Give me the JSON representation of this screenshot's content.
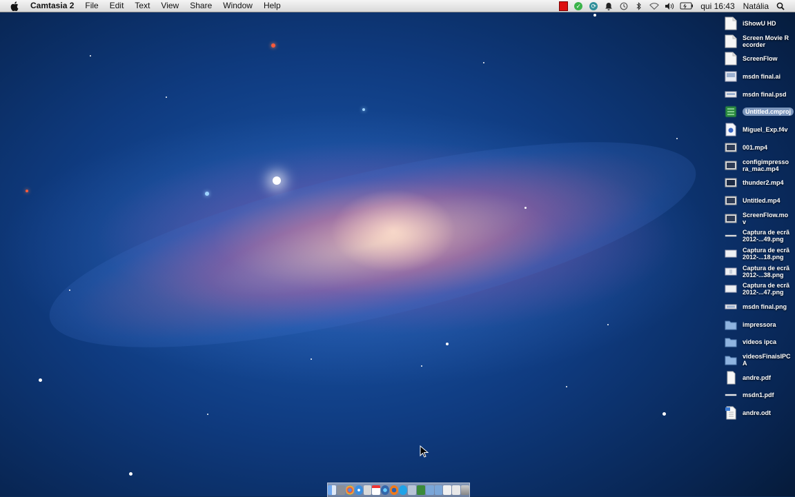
{
  "menubar": {
    "app_name": "Camtasia 2",
    "menus": [
      "File",
      "Edit",
      "Text",
      "View",
      "Share",
      "Window",
      "Help"
    ],
    "clock": "qui 16:43",
    "user": "Natália"
  },
  "desktop_items": [
    {
      "label": "iShowU HD",
      "icon": "document-icon"
    },
    {
      "label": "Screen Movie Recorder",
      "icon": "document-icon"
    },
    {
      "label": "ScreenFlow",
      "icon": "document-icon"
    },
    {
      "label": "msdn final.ai",
      "icon": "image-file-icon"
    },
    {
      "label": "msdn final.psd",
      "icon": "image-file-icon"
    },
    {
      "label": "Untitled.cmproj",
      "icon": "camtasia-project-icon",
      "selected": true
    },
    {
      "label": "Miguel_Exp.f4v",
      "icon": "video-file-icon"
    },
    {
      "label": "001.mp4",
      "icon": "video-file-icon"
    },
    {
      "label": "configimpressora_mac.mp4",
      "icon": "video-file-icon"
    },
    {
      "label": "thunder2.mp4",
      "icon": "video-file-icon"
    },
    {
      "label": "Untitled.mp4",
      "icon": "video-file-icon"
    },
    {
      "label": "ScreenFlow.mov",
      "icon": "video-file-icon"
    },
    {
      "label": "Captura de ecrã 2012-...49.png",
      "icon": "screenshot-file-icon"
    },
    {
      "label": "Captura de ecrã 2012-...18.png",
      "icon": "screenshot-file-icon"
    },
    {
      "label": "Captura de ecrã 2012-...38.png",
      "icon": "screenshot-file-icon"
    },
    {
      "label": "Captura de ecrã 2012-...47.png",
      "icon": "screenshot-file-icon"
    },
    {
      "label": "msdn final.png",
      "icon": "image-file-icon"
    },
    {
      "label": "impressora",
      "icon": "folder-icon"
    },
    {
      "label": "videos ipca",
      "icon": "folder-icon"
    },
    {
      "label": "videosFinaisIPCA",
      "icon": "folder-icon"
    },
    {
      "label": "andre.pdf",
      "icon": "pdf-file-icon"
    },
    {
      "label": "msdn1.pdf",
      "icon": "pdf-file-icon"
    },
    {
      "label": "andre.odt",
      "icon": "text-document-icon"
    }
  ],
  "colors": {
    "menubar": "#e6e6e6",
    "selection": "#7d97bd",
    "folder": "#8fb4e0"
  }
}
